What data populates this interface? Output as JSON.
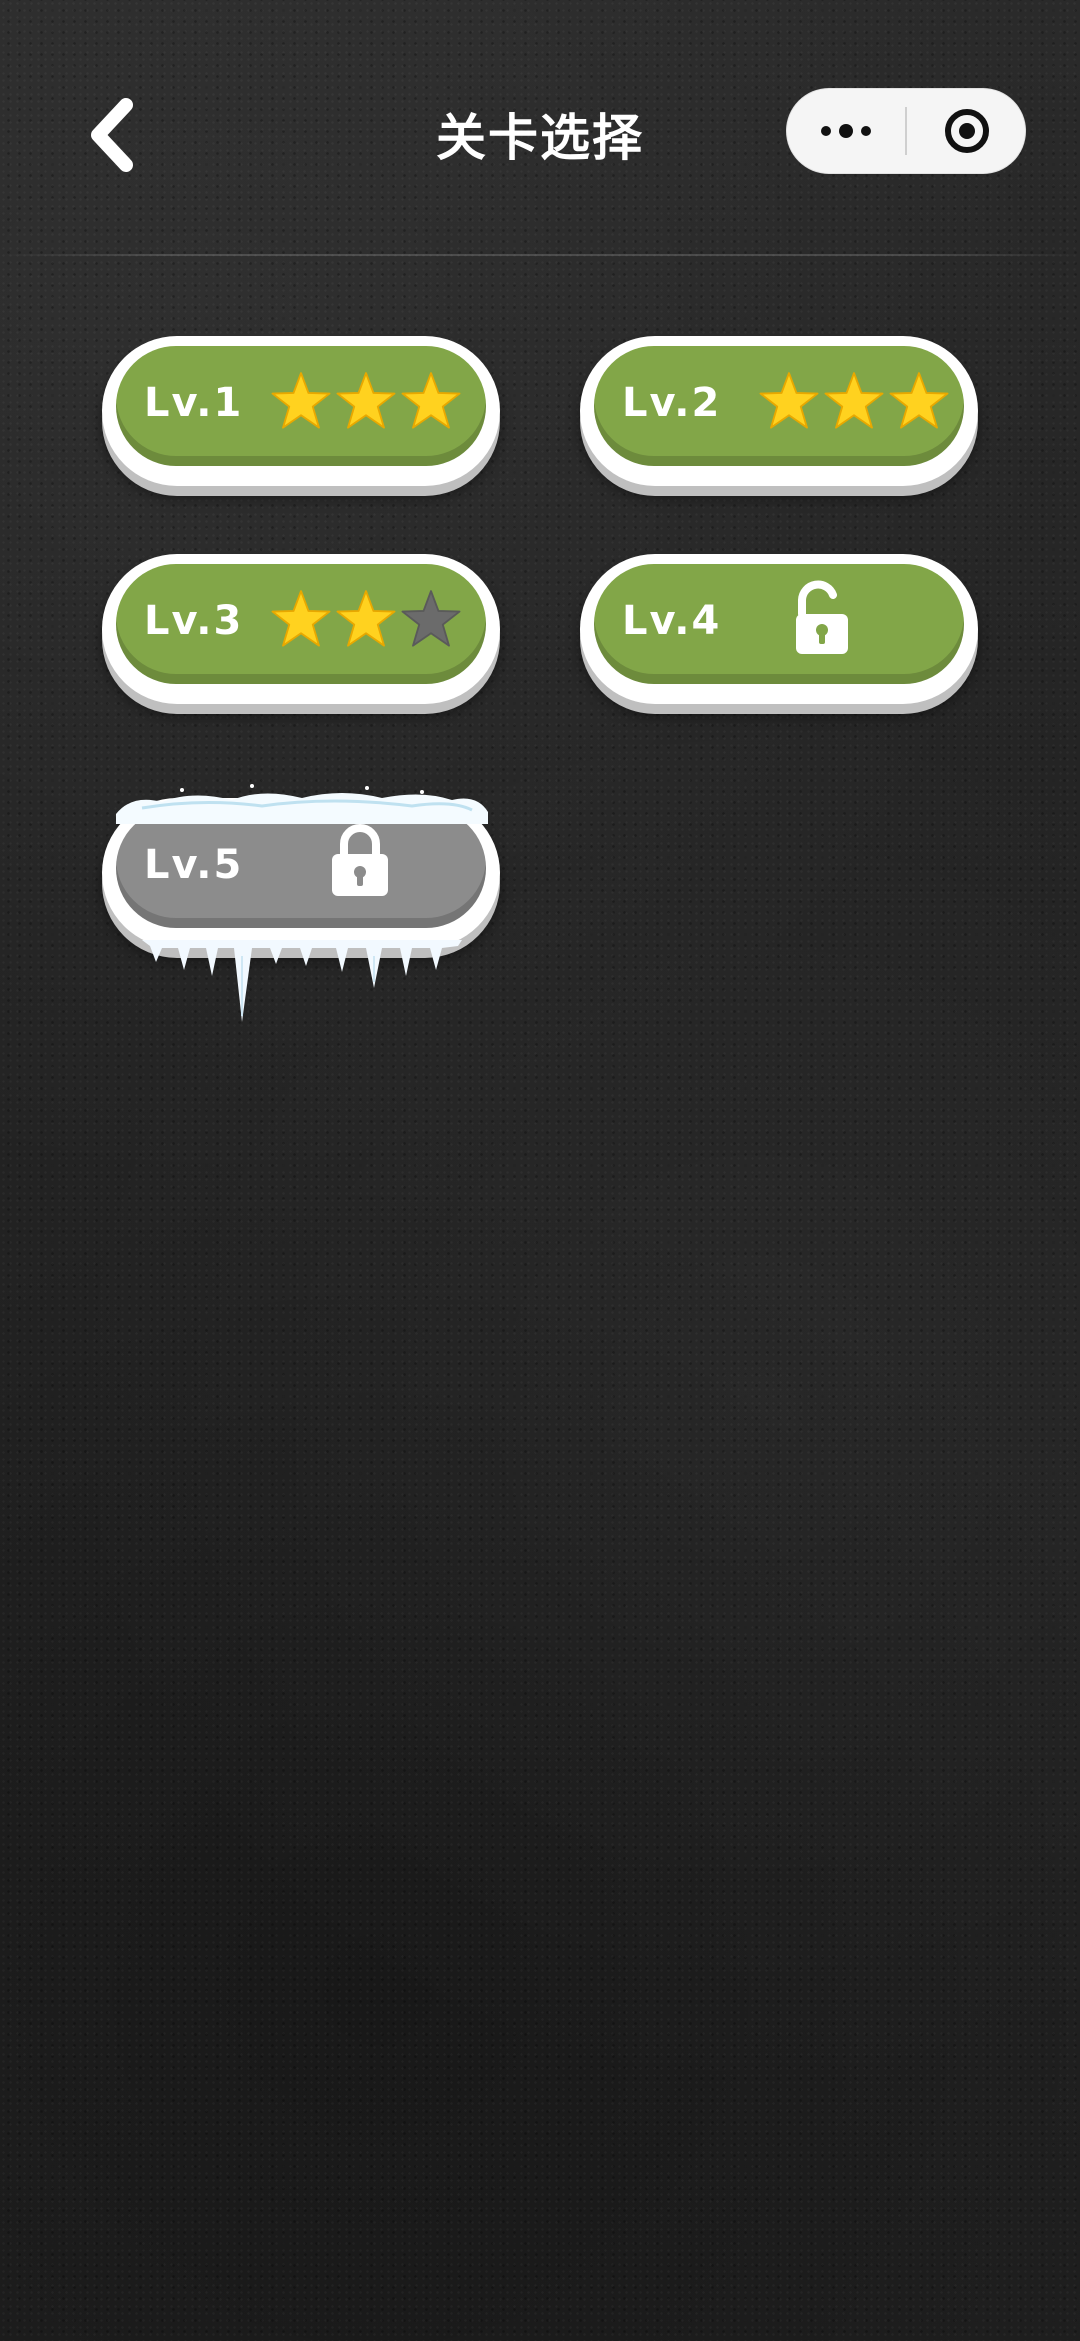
{
  "header": {
    "title": "关卡选择"
  },
  "levels": [
    {
      "label": "Lv.1",
      "stars": 3,
      "status": "completed"
    },
    {
      "label": "Lv.2",
      "stars": 3,
      "status": "completed"
    },
    {
      "label": "Lv.3",
      "stars": 2,
      "status": "completed"
    },
    {
      "label": "Lv.4",
      "stars": 0,
      "status": "unlocked"
    },
    {
      "label": "Lv.5",
      "stars": 0,
      "status": "locked-frozen"
    }
  ],
  "colors": {
    "level_green": "#82a648",
    "level_locked": "#8c8c8c",
    "star_filled": "#ffd21f",
    "star_empty": "#6b6b6b"
  }
}
